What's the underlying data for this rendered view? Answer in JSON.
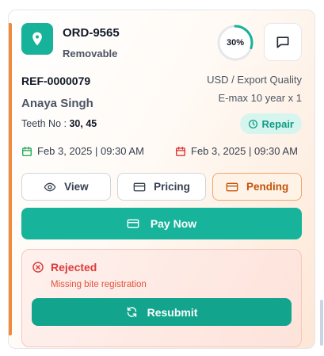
{
  "order": {
    "id": "ORD-9565",
    "type": "Removable",
    "progress_label": "30%",
    "progress_fraction": 0.3
  },
  "details": {
    "reference": "REF-0000079",
    "patient_name": "Anaya Singh",
    "teeth_label": "Teeth No :",
    "teeth_value": "30, 45",
    "currency_quality": "USD / Export Quality",
    "material": "E-max 10 year x 1",
    "category_badge": "Repair"
  },
  "dates": {
    "start": "Feb 3, 2025 | 09:30 AM",
    "due": "Feb 3, 2025 | 09:30 AM"
  },
  "actions": {
    "view_label": "View",
    "pricing_label": "Pricing",
    "pending_label": "Pending",
    "pay_label": "Pay Now"
  },
  "rejection": {
    "status": "Rejected",
    "reason": "Missing bite registration",
    "resubmit_label": "Resubmit"
  },
  "colors": {
    "brand_teal": "#17b29a",
    "accent_orange": "#f08a3c",
    "pending_orange": "#c2540a",
    "reject_red": "#dc3b3b",
    "start_date_green": "#16a34a",
    "due_date_red": "#dc2626"
  },
  "icons": {
    "order_icon": "map-pin-icon",
    "chat": "message-square-icon",
    "repair": "clock-icon",
    "start_date": "calendar-icon",
    "due_date": "calendar-icon",
    "view": "eye-icon",
    "pricing": "credit-card-icon",
    "pending": "credit-card-icon",
    "pay": "credit-card-icon",
    "rejected": "x-circle-icon",
    "resubmit": "refresh-icon"
  }
}
